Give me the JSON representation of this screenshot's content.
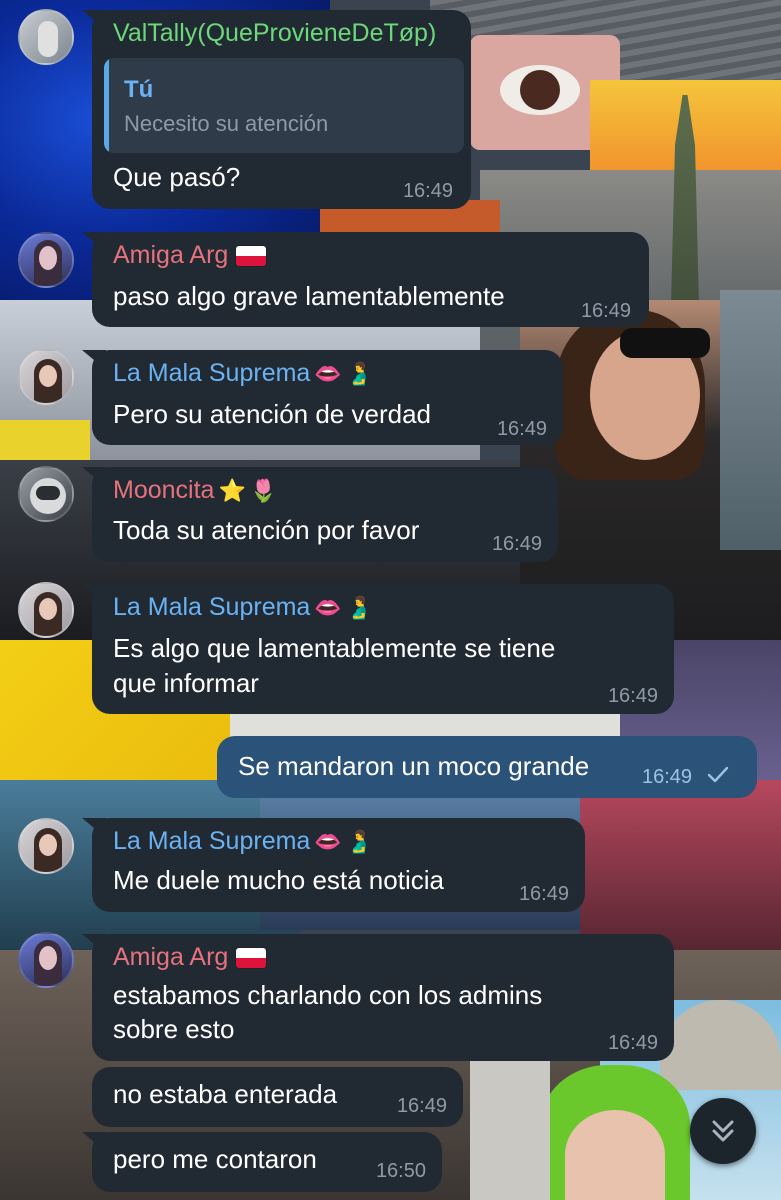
{
  "colors": {
    "bubble_in": "#212a33",
    "bubble_out": "#2b5278",
    "time_gray": "#8e9aa7",
    "name_green": "#6dd87a",
    "name_red": "#e5727d",
    "name_blue": "#6ab2f2",
    "check": "#9fc2e4"
  },
  "messages": [
    {
      "sender": "ValTally(QueProvieneDeTøp)",
      "reply": {
        "name": "Tú",
        "text": "Necesito su atención"
      },
      "lines": [
        "Que pasó?"
      ],
      "time": "16:49"
    },
    {
      "sender": "Amiga Arg",
      "sender_icons": [
        "flag-poland-icon"
      ],
      "lines": [
        "paso algo grave lamentablemente"
      ],
      "time": "16:49"
    },
    {
      "sender": "La Mala Suprema",
      "sender_icons": [
        "lips-icon",
        "pregnant-man-icon"
      ],
      "lines": [
        "Pero su atención de verdad"
      ],
      "time": "16:49"
    },
    {
      "sender": "Mooncita",
      "sender_icons": [
        "star-icon",
        "tulip-icon"
      ],
      "lines": [
        "Toda su atención por favor"
      ],
      "time": "16:49"
    },
    {
      "sender": "La Mala Suprema",
      "sender_icons": [
        "lips-icon",
        "pregnant-man-icon"
      ],
      "lines": [
        "Es algo que lamentablemente se tiene",
        "que informar"
      ],
      "time": "16:49"
    },
    {
      "outgoing": true,
      "lines": [
        "Se mandaron un moco grande"
      ],
      "time": "16:49",
      "status_icon": "check-icon"
    },
    {
      "sender": "La Mala Suprema",
      "sender_icons": [
        "lips-icon",
        "pregnant-man-icon"
      ],
      "lines": [
        "Me duele mucho está noticia"
      ],
      "time": "16:49"
    },
    {
      "sender": "Amiga Arg",
      "sender_icons": [
        "flag-poland-icon"
      ],
      "lines": [
        "estabamos charlando con los admins",
        "sobre esto"
      ],
      "time": "16:49"
    },
    {
      "lines": [
        "no estaba enterada"
      ],
      "time": "16:49"
    },
    {
      "lines": [
        "pero me contaron"
      ],
      "time": "16:50"
    }
  ],
  "emoji": {
    "lips": "👄",
    "pregnant_man": "🫃",
    "star": "⭐",
    "tulip": "🌷"
  },
  "scroll_button": {
    "icon": "double-chevron-down-icon"
  }
}
